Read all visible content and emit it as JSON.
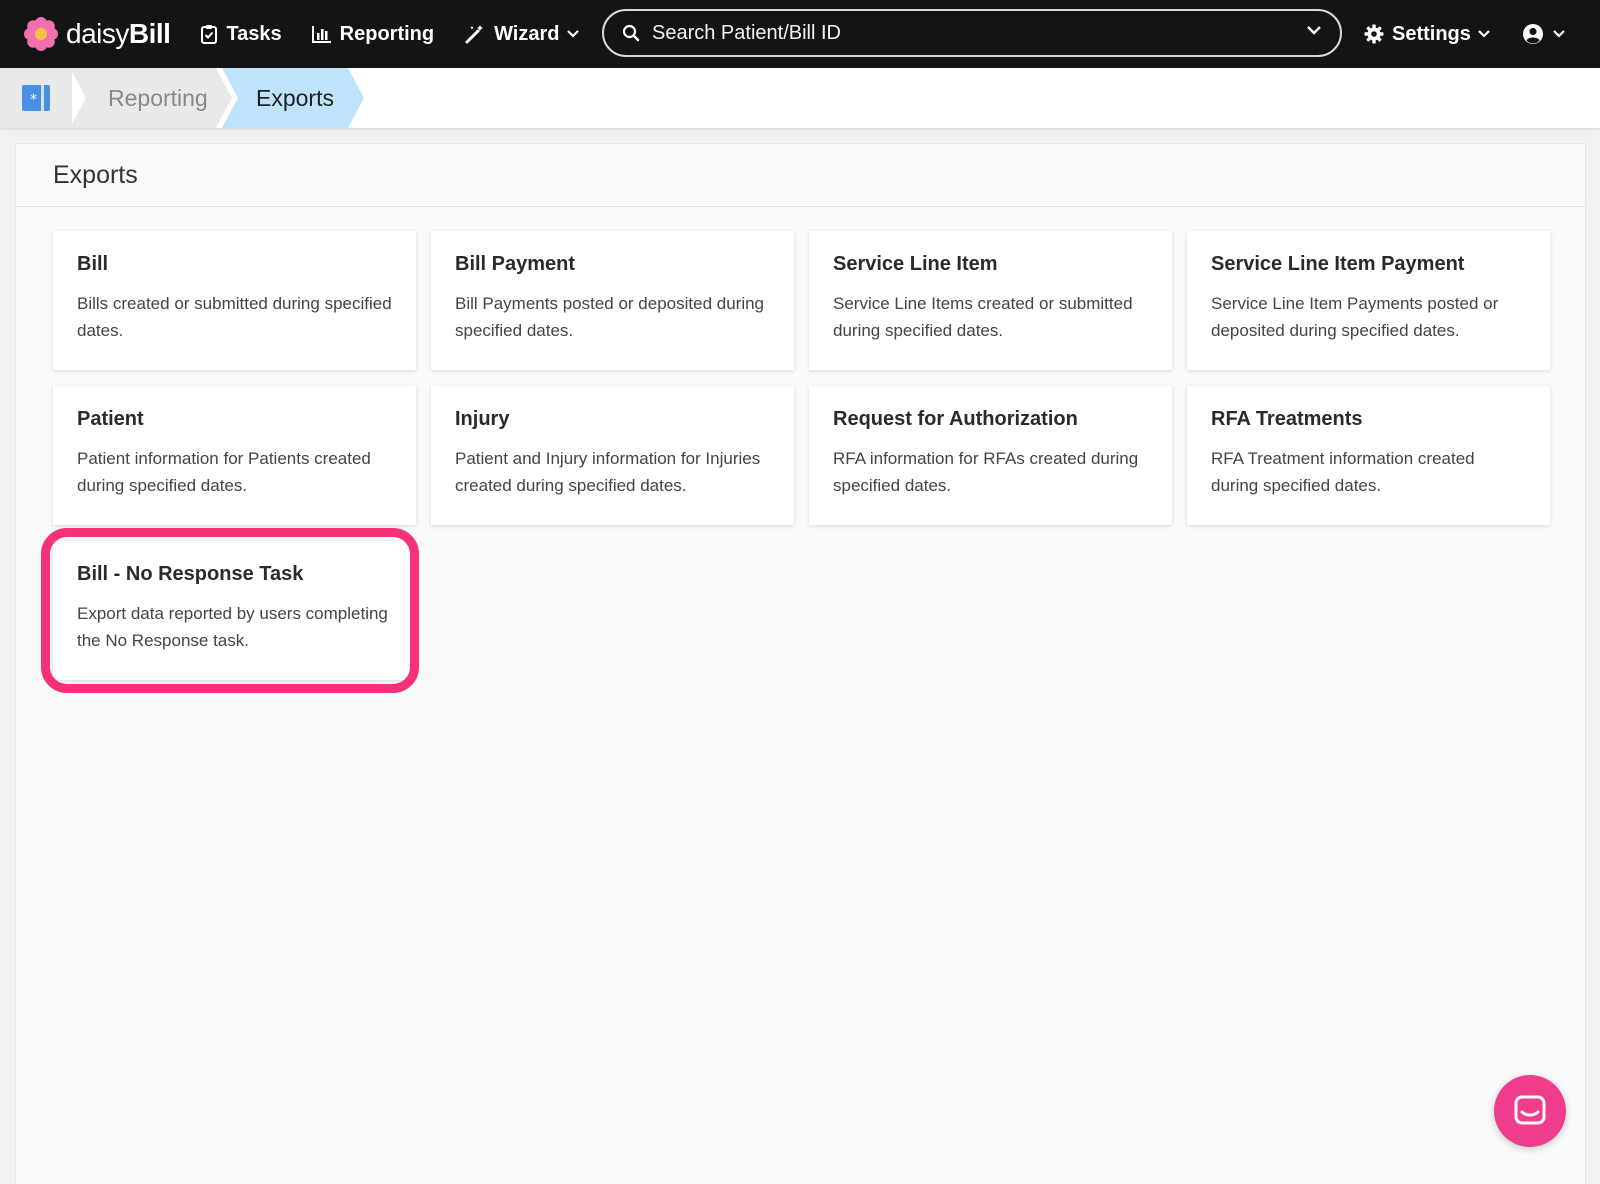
{
  "nav": {
    "logo_prefix": "daisy",
    "logo_suffix": "Bill",
    "tasks_label": "Tasks",
    "reporting_label": "Reporting",
    "wizard_label": "Wizard",
    "search_placeholder": "Search Patient/Bill ID",
    "settings_label": "Settings"
  },
  "breadcrumb": {
    "items": [
      "Reporting",
      "Exports"
    ]
  },
  "page": {
    "title": "Exports"
  },
  "cards": [
    {
      "title": "Bill",
      "description": "Bills created or submitted during specified dates."
    },
    {
      "title": "Bill Payment",
      "description": "Bill Payments posted or deposited during specified dates."
    },
    {
      "title": "Service Line Item",
      "description": "Service Line Items created or submitted during specified dates."
    },
    {
      "title": "Service Line Item Payment",
      "description": "Service Line Item Payments posted or deposited during specified dates."
    },
    {
      "title": "Patient",
      "description": "Patient information for Patients created during specified dates."
    },
    {
      "title": "Injury",
      "description": "Patient and Injury information for Injuries created during specified dates."
    },
    {
      "title": "Request for Authorization",
      "description": "RFA information for RFAs created during specified dates."
    },
    {
      "title": "RFA Treatments",
      "description": "RFA Treatment information created during specified dates."
    },
    {
      "title": "Bill - No Response Task",
      "description": "Export data reported by users completing the No Response task."
    }
  ],
  "colors": {
    "nav_bg": "#141414",
    "breadcrumb_active": "#bfe3fb",
    "highlight": "#f7307a",
    "chat_button": "#f03c8c"
  }
}
